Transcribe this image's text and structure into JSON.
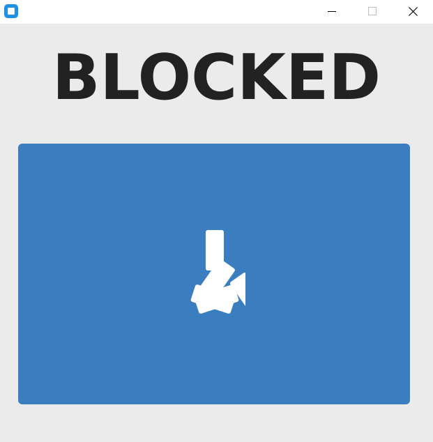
{
  "window": {
    "app_icon": "app-icon",
    "controls": [
      "minimize-icon",
      "maximize-icon",
      "close-icon"
    ]
  },
  "main": {
    "heading": "BLOCKED",
    "panel_icon": "asterisk-icon",
    "panel_color": "#3b7ec0"
  }
}
